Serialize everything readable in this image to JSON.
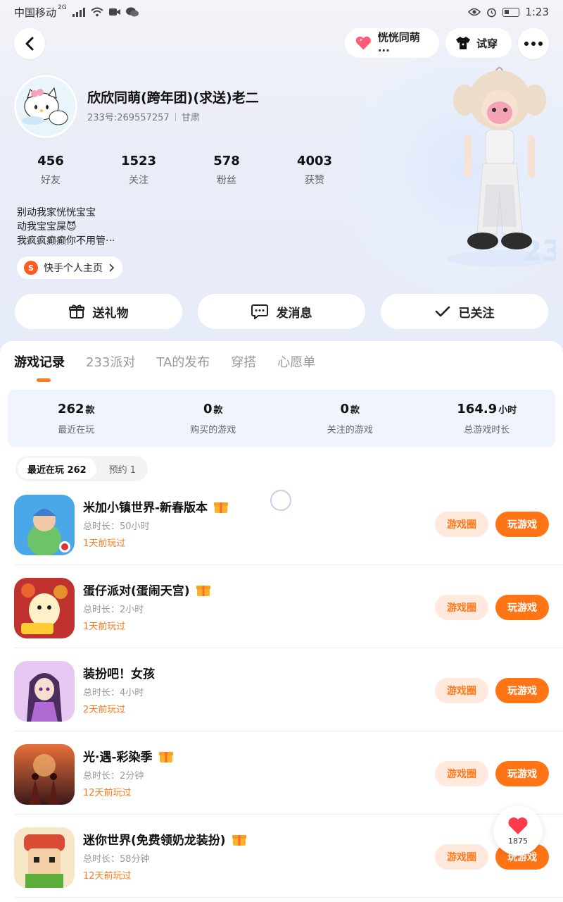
{
  "status_bar": {
    "carrier": "中国移动",
    "network": "2G",
    "time": "1:23"
  },
  "header": {
    "back_icon": "chevron-left-icon",
    "companion_label": "恍恍同萌···",
    "try_on_label": "试穿",
    "more_icon": "more-dots-icon"
  },
  "profile": {
    "nickname": "欣欣同萌(跨年团)(求送)老二",
    "id_text": "233号:269557257",
    "region": "甘肃",
    "stats": [
      {
        "value": "456",
        "label": "好友"
      },
      {
        "value": "1523",
        "label": "关注"
      },
      {
        "value": "578",
        "label": "粉丝"
      },
      {
        "value": "4003",
        "label": "获赞"
      }
    ],
    "bio_lines": [
      "别动我家恍恍宝宝",
      "动我宝宝屎😈",
      "我疯疯癫癫你不用管···"
    ],
    "kuaishou_icon_text": "S",
    "kuaishou_link": "快手个人主页"
  },
  "actions": {
    "gift_label": "送礼物",
    "message_label": "发消息",
    "follow_label": "已关注"
  },
  "tabs": [
    "游戏记录",
    "233派对",
    "TA的发布",
    "穿搭",
    "心愿单"
  ],
  "summary": [
    {
      "value": "262",
      "unit": "款",
      "label": "最近在玩"
    },
    {
      "value": "0",
      "unit": "款",
      "label": "购买的游戏"
    },
    {
      "value": "0",
      "unit": "款",
      "label": "关注的游戏"
    },
    {
      "value": "164.9",
      "unit": "小时",
      "label": "总游戏时长"
    }
  ],
  "segments": [
    "最近在玩 262",
    "预约 1"
  ],
  "games": [
    {
      "name": "米加小镇世界-新春版本",
      "duration": "总时长：50小时",
      "last": "1天前玩过",
      "circle": "游戏圈",
      "play": "玩游戏",
      "icon_color": "#4aa8e8"
    },
    {
      "name": "蛋仔派对(蛋闹天宫)",
      "duration": "总时长：2小时",
      "last": "1天前玩过",
      "circle": "游戏圈",
      "play": "玩游戏",
      "icon_color": "#c0322f"
    },
    {
      "name": "装扮吧！女孩",
      "duration": "总时长：4小时",
      "last": "2天前玩过",
      "circle": "游戏圈",
      "play": "玩游戏",
      "icon_color": "#b06ad4"
    },
    {
      "name": "光·遇-彩染季",
      "duration": "总时长：2分钟",
      "last": "12天前玩过",
      "circle": "游戏圈",
      "play": "玩游戏",
      "icon_color": "#c8452a"
    },
    {
      "name": "迷你世界(免费领奶龙装扮)",
      "duration": "总时长：58分钟",
      "last": "12天前玩过",
      "circle": "游戏圈",
      "play": "玩游戏",
      "icon_color": "#d94b34"
    }
  ],
  "floating_like": {
    "count": "1875"
  }
}
